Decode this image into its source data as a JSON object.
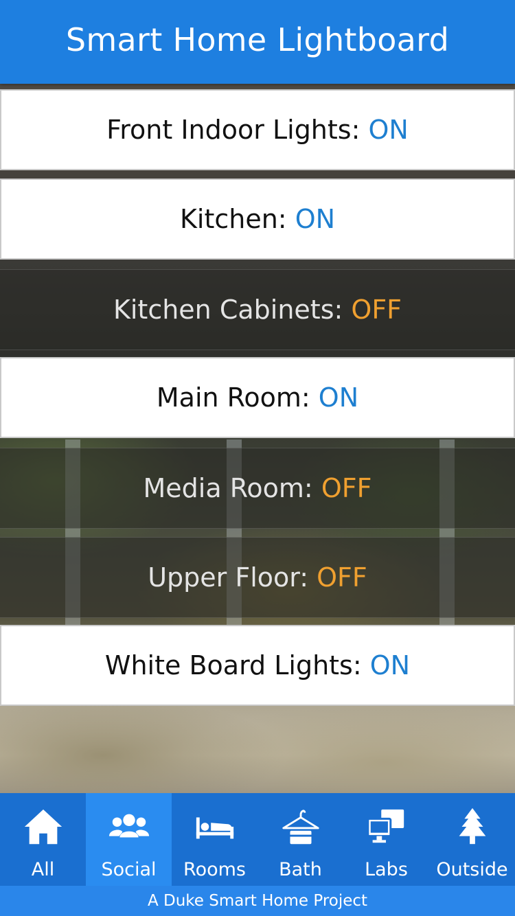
{
  "app": {
    "title": "Smart Home Lightboard"
  },
  "lights": [
    {
      "name": "Front Indoor Lights:",
      "state": "ON"
    },
    {
      "name": "Kitchen:",
      "state": "ON"
    },
    {
      "name": "Kitchen Cabinets:",
      "state": "OFF"
    },
    {
      "name": "Main Room:",
      "state": "ON"
    },
    {
      "name": "Media Room:",
      "state": "OFF"
    },
    {
      "name": "Upper Floor:",
      "state": "OFF"
    },
    {
      "name": "White Board Lights:",
      "state": "ON"
    }
  ],
  "tabs": [
    {
      "label": "All",
      "icon": "home-icon"
    },
    {
      "label": "Social",
      "icon": "users-icon",
      "active": true
    },
    {
      "label": "Rooms",
      "icon": "bed-icon"
    },
    {
      "label": "Bath",
      "icon": "hanger-icon"
    },
    {
      "label": "Labs",
      "icon": "desktop-icon"
    },
    {
      "label": "Outside",
      "icon": "tree-icon"
    }
  ],
  "footer": {
    "text": "A Duke Smart Home Project"
  },
  "colors": {
    "header": "#1e7fe0",
    "on": "#1e7fd0",
    "off": "#f0a030",
    "tabbar": "#1a6fd0",
    "tab_active": "#2a8cf0"
  }
}
